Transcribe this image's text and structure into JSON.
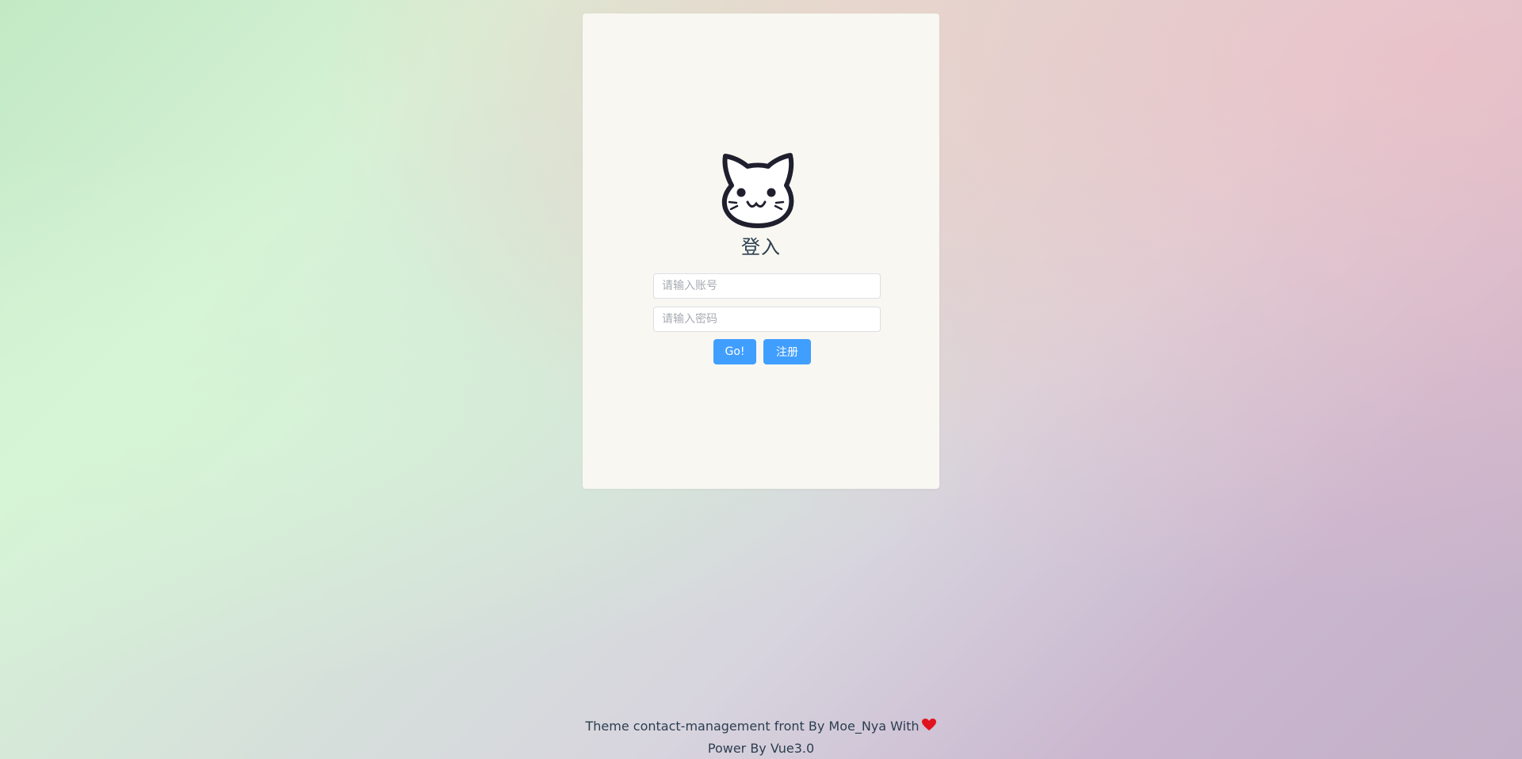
{
  "login": {
    "title": "登入",
    "logo_icon": "cat-face-icon",
    "account_placeholder": "请输入账号",
    "account_value": "",
    "password_placeholder": "请输入密码",
    "password_value": "",
    "go_label": "Go!",
    "register_label": "注册"
  },
  "footer": {
    "line1": "Theme contact-management front By Moe_Nya With",
    "heart_icon": "heart-icon",
    "line2": "Power By Vue3.0"
  },
  "colors": {
    "primary_button": "#409eff",
    "card_background": "#f8f7f1",
    "heart": "#e0141e",
    "text": "#2c3e50"
  }
}
